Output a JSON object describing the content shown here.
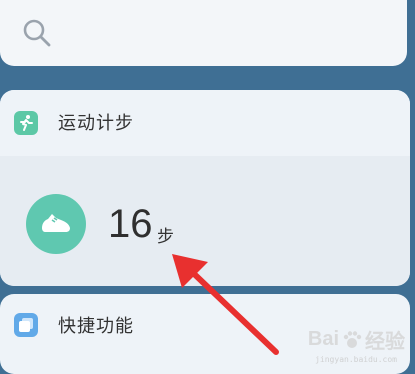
{
  "search": {
    "icon": "search-icon"
  },
  "steps_card": {
    "title": "运动计步",
    "header_icon": "running-person-icon",
    "shoe_icon": "shoe-icon",
    "count": "16",
    "unit": "步",
    "accent_color": "#5cc8a6"
  },
  "shortcuts_card": {
    "title": "快捷功能",
    "header_icon": "shortcut-square-icon",
    "accent_color": "#61a9e8"
  },
  "annotation": {
    "arrow_color": "#e8302f"
  },
  "watermark": {
    "brand": "Bai",
    "suffix": "经验",
    "url": "jingyan.baidu.com"
  }
}
